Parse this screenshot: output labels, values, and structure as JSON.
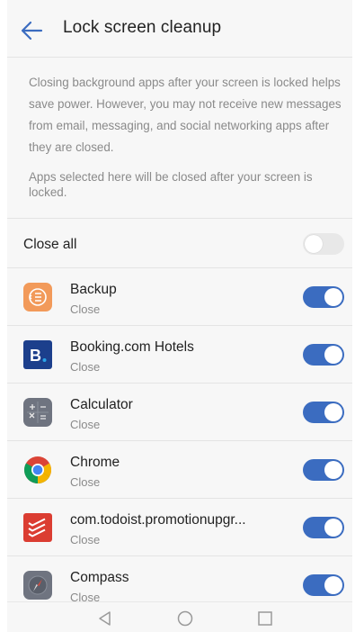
{
  "header": {
    "title": "Lock screen cleanup",
    "back_icon": "arrow-left-icon"
  },
  "description": {
    "paragraph1": "Closing background apps after your screen is locked helps save power. However, you may not receive new messages from email, messaging, and social networking apps after they are closed.",
    "paragraph2": "Apps selected here will be closed after your screen is locked."
  },
  "close_all": {
    "label": "Close all",
    "enabled": false
  },
  "apps": [
    {
      "name": "Backup",
      "status": "Close",
      "enabled": true,
      "icon": "backup-icon"
    },
    {
      "name": "Booking.com Hotels",
      "status": "Close",
      "enabled": true,
      "icon": "booking-icon"
    },
    {
      "name": "Calculator",
      "status": "Close",
      "enabled": true,
      "icon": "calculator-icon"
    },
    {
      "name": "Chrome",
      "status": "Close",
      "enabled": true,
      "icon": "chrome-icon"
    },
    {
      "name": "com.todoist.promotionupgr...",
      "status": "Close",
      "enabled": true,
      "icon": "todoist-icon"
    },
    {
      "name": "Compass",
      "status": "Close",
      "enabled": true,
      "icon": "compass-icon"
    }
  ],
  "navbar": {
    "buttons": [
      "back-triangle-icon",
      "home-circle-icon",
      "recents-square-icon"
    ]
  },
  "colors": {
    "accent": "#3b6cc0",
    "background": "#f7f7f7",
    "secondary_text": "#8a8a8a"
  }
}
